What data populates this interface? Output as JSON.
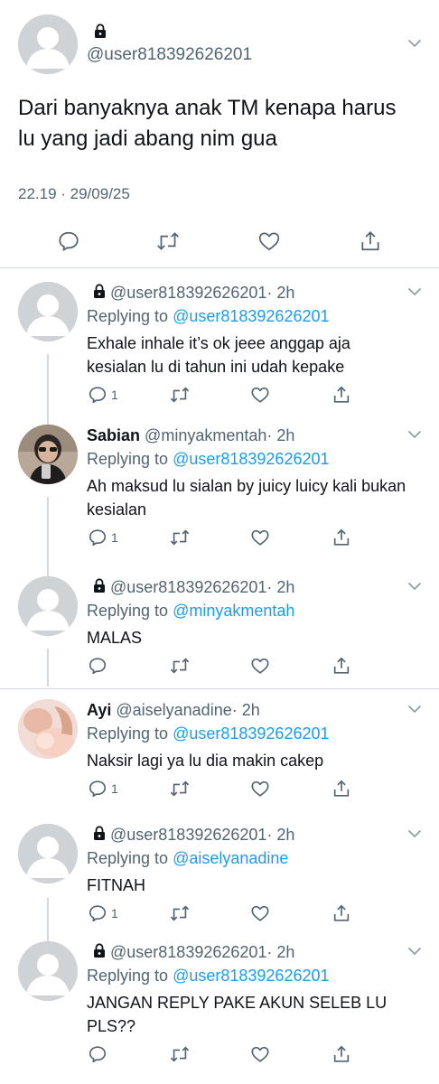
{
  "main_tweet": {
    "handle": "@user818392626201",
    "text": "Dari banyaknya anak TM kenapa harus lu yang jadi abang nim gua",
    "timestamp": "22.19 · 29/09/25",
    "icons": [
      "lock-icon",
      "chevron-down-icon",
      "reply-icon",
      "retweet-icon",
      "like-icon",
      "share-icon"
    ]
  },
  "replies": [
    {
      "name": "",
      "handle": "@user818392626201",
      "time": "· 2h",
      "replying_label": "Replying to",
      "replying_to": "@user818392626201",
      "text": "Exhale inhale it’s ok jeee anggap aja kesialan lu di tahun ini udah kepake",
      "reply_count": "1",
      "locked": true
    },
    {
      "name": "Sabian",
      "handle": "@minyakmentah",
      "time": "· 2h",
      "replying_label": "Replying to",
      "replying_to": "@user818392626201",
      "text": "Ah maksud lu sialan by juicy luicy kali bukan kesialan",
      "reply_count": "1",
      "locked": false
    },
    {
      "name": "",
      "handle": "@user818392626201",
      "time": "· 2h",
      "replying_label": "Replying to",
      "replying_to": "@minyakmentah",
      "text": "MALAS",
      "reply_count": "",
      "locked": true
    },
    {
      "name": "Ayi",
      "handle": "@aiselyanadine",
      "time": "· 2h",
      "replying_label": "Replying to",
      "replying_to": "@user818392626201",
      "text": "Naksir lagi ya lu dia makin cakep",
      "reply_count": "1",
      "locked": false
    },
    {
      "name": "",
      "handle": "@user818392626201",
      "time": "· 2h",
      "replying_label": "Replying to",
      "replying_to": "@aiselyanadine",
      "text": "FITNAH",
      "reply_count": "1",
      "locked": true
    },
    {
      "name": "",
      "handle": "@user818392626201",
      "time": "· 2h",
      "replying_label": "Replying to",
      "replying_to": "@user818392626201",
      "text": "JANGAN REPLY PAKE AKUN SELEB LU PLS??",
      "reply_count": "",
      "locked": true
    }
  ],
  "colors": {
    "text": "#0f1419",
    "muted": "#536471",
    "link": "#1d9bf0",
    "divider": "#cfd9de",
    "placeholder_avatar": "#d0d3d6"
  }
}
